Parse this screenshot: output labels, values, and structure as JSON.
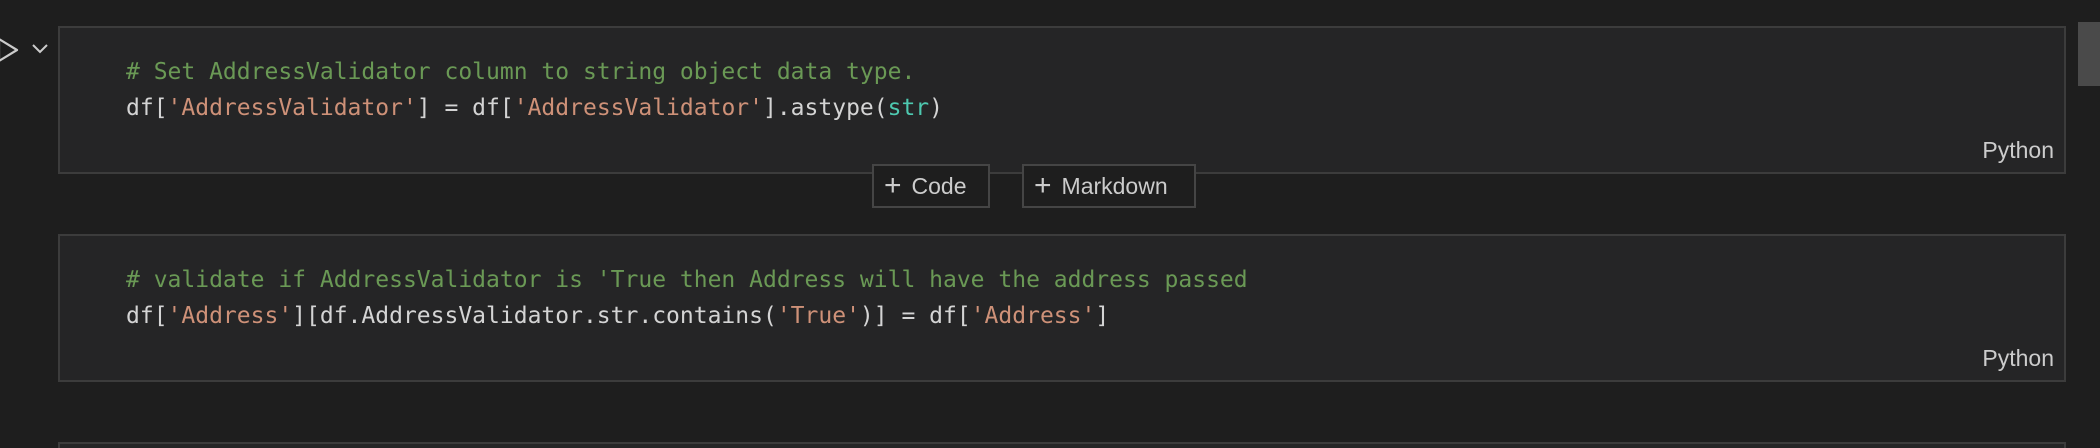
{
  "cells": [
    {
      "language": "Python",
      "lines": [
        [
          {
            "t": "comment",
            "s": "# Set AddressValidator column to string object data type."
          }
        ],
        [
          {
            "t": "plain",
            "s": "df["
          },
          {
            "t": "string",
            "s": "'AddressValidator'"
          },
          {
            "t": "plain",
            "s": "] = df["
          },
          {
            "t": "string",
            "s": "'AddressValidator'"
          },
          {
            "t": "plain",
            "s": "].astype("
          },
          {
            "t": "builtin",
            "s": "str"
          },
          {
            "t": "plain",
            "s": ")"
          }
        ]
      ]
    },
    {
      "language": "Python",
      "lines": [
        [
          {
            "t": "comment",
            "s": "# validate if AddressValidator is 'True then Address will have the address passed"
          }
        ],
        [
          {
            "t": "plain",
            "s": "df["
          },
          {
            "t": "string",
            "s": "'Address'"
          },
          {
            "t": "plain",
            "s": "][df.AddressValidator.str.contains("
          },
          {
            "t": "string",
            "s": "'True'"
          },
          {
            "t": "plain",
            "s": ")] = df["
          },
          {
            "t": "string",
            "s": "'Address'"
          },
          {
            "t": "plain",
            "s": "]"
          }
        ]
      ]
    }
  ],
  "toolbar": {
    "add_code_label": "Code",
    "add_markdown_label": "Markdown",
    "plus_glyph": "+"
  },
  "icons": {
    "run": "run-cell-icon",
    "chevron": "chevron-down-icon"
  },
  "colors": {
    "background": "#1e1e1e",
    "cell_background": "#252526",
    "comment": "#6a9955",
    "string": "#ce9178",
    "builtin": "#4ec9b0",
    "text": "#d4d4d4"
  }
}
